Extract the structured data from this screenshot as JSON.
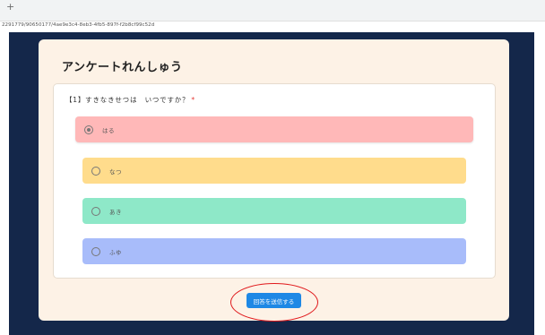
{
  "browser": {
    "new_tab_symbol": "+",
    "url": "2291779/90650177/4ae9e3c4-8eb3-4fb5-897f-f2b8cf99c52d"
  },
  "survey": {
    "title": "アンケートれんしゅう",
    "question": {
      "label": "【1】すきなきせつは　いつですか？",
      "required_mark": "*",
      "options": [
        {
          "label": "はる",
          "selected": true,
          "color": "#ffb8b8"
        },
        {
          "label": "なつ",
          "selected": false,
          "color": "#ffdc8c"
        },
        {
          "label": "あき",
          "selected": false,
          "color": "#8ee8c8"
        },
        {
          "label": "ふゆ",
          "selected": false,
          "color": "#a8bcfa"
        }
      ]
    },
    "submit_label": "回答を送信する"
  },
  "colors": {
    "page_background": "#14274a",
    "card_background": "#fdf2e6",
    "submit_button": "#1e88e5",
    "annotation_circle": "#e0181b"
  }
}
